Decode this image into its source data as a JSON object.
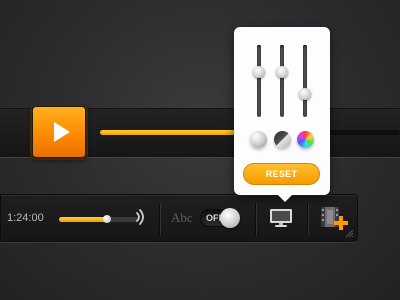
{
  "player": {
    "progress": 0.45
  },
  "control_bar": {
    "time": "1:24:00",
    "volume": 0.6,
    "toggle_label": "OFF",
    "caption_label": "Abc"
  },
  "popup": {
    "sliders": [
      {
        "id": "brightness",
        "value": 0.62
      },
      {
        "id": "contrast",
        "value": 0.62
      },
      {
        "id": "saturation",
        "value": 0.32
      }
    ],
    "reset_label": "RESET"
  },
  "icons": {
    "play": "play-icon",
    "speaker": "speaker-icon",
    "monitor": "monitor-icon",
    "film_add": "film-add-icon"
  },
  "colors": {
    "accent": "#ff9500",
    "accent_light": "#ffcb3a",
    "bar_bg": "#1a1a1b",
    "popup_bg": "#fdfdfd"
  }
}
